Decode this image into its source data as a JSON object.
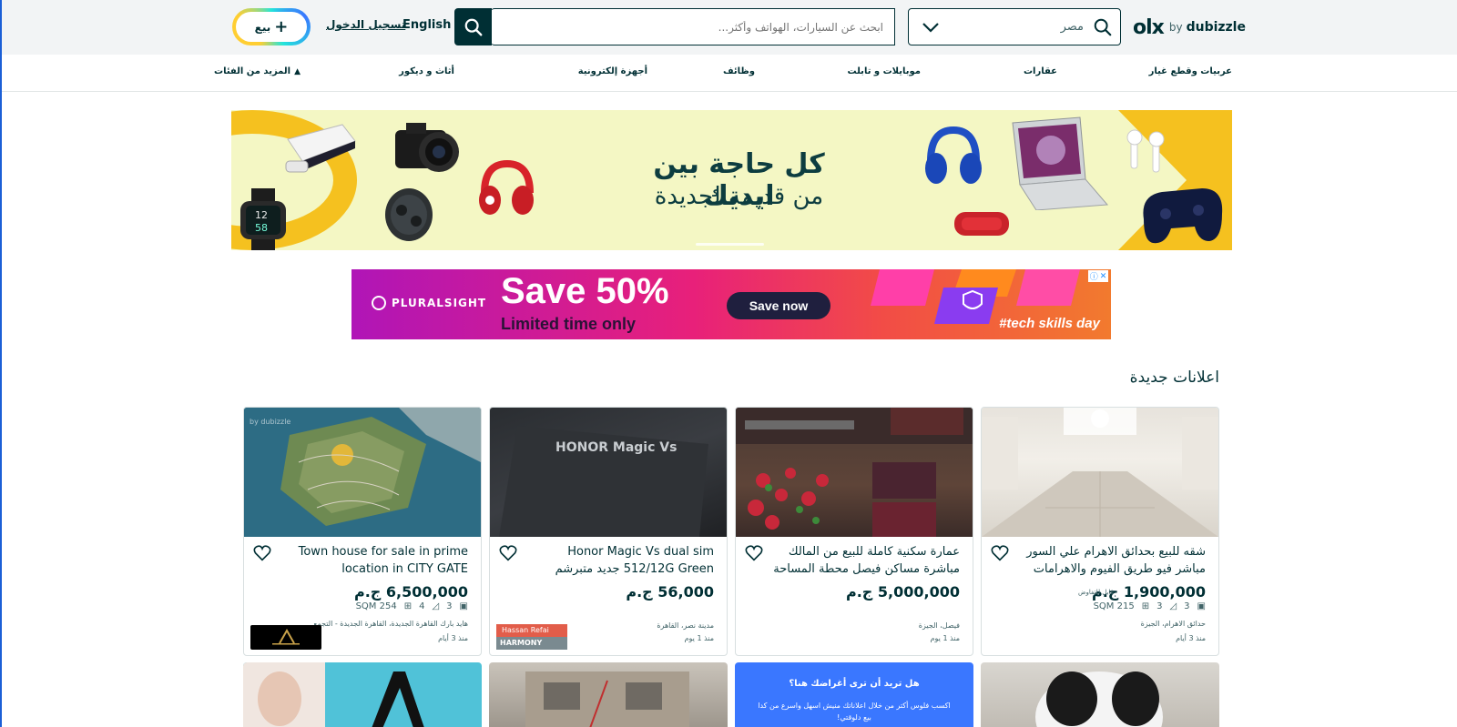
{
  "header": {
    "logo_olx": "olx",
    "logo_by": "by",
    "logo_dubizzle": "dubizzle",
    "location": "مصر",
    "search_placeholder": "ابحث عن السيارات، الهواتف وأكثر...",
    "language": "English",
    "login": "تسجيل الدخول",
    "sell": "بيع"
  },
  "categories": [
    "عربيات وقطع غيار",
    "عقارات",
    "موبايلات و تابلت",
    "وظائف",
    "أجهزة إلكترونية",
    "أثاث و ديكور",
    "المزيد من الفئات"
  ],
  "hero": {
    "line1": "كل حاجة بين ايديك",
    "line2": "من قديمة لجديدة"
  },
  "ad": {
    "brand": "PLURALSIGHT",
    "headline": "Save 50%",
    "subline": "Limited time only",
    "cta": "Save now",
    "tag": "#tech skills day"
  },
  "section_title": "اعلانات جديدة",
  "listings": [
    {
      "title": "شقه للبيع بحدائق الاهرام علي السور مباشر فيو طريق الفيوم والاهرامات",
      "price": "1,900,000 ج.م",
      "negotiable": "قابل للتفاوض",
      "beds": "3",
      "baths": "3",
      "area": "SQM 215",
      "location": "حدائق الاهرام، الجيزة",
      "date": "منذ 3 أيام"
    },
    {
      "title": "عمارة سكنية كاملة للبيع من المالك مباشرة مساكن فيصل محطة المساحة",
      "price": "5,000,000 ج.م",
      "location": "فيصل، الجيزة",
      "date": "منذ 1 يوم"
    },
    {
      "title": "Honor Magic Vs dual sim 512/12G Green جديد متبرشم",
      "price": "56,000 ج.م",
      "location": "مدينة نصر، القاهرة",
      "date": "منذ 1 يوم",
      "badge_top": "Hassan Refai",
      "badge_bottom": "HARMONY PHONE"
    },
    {
      "title": "Town house for sale in prime location in CITY GATE",
      "price": "6,500,000 ج.م",
      "beds": "3",
      "baths": "4",
      "area": "SQM 254",
      "location": "هايد بارك القاهرة الجديدة، القاهرة الجديدة - التجمع",
      "date": "منذ 3 أيام"
    }
  ],
  "promo": {
    "title": "هل تريد أن ترى أغراضك هنا؟",
    "body": "اكسب فلوس أكتر من خلال اعلاناتك منيش اسهل واسرع من كدا بيع دلوقتي!"
  },
  "image_texts": {
    "honor": "HONOR Magic Vs",
    "dubizzle_watermark": "by dubizzle"
  }
}
